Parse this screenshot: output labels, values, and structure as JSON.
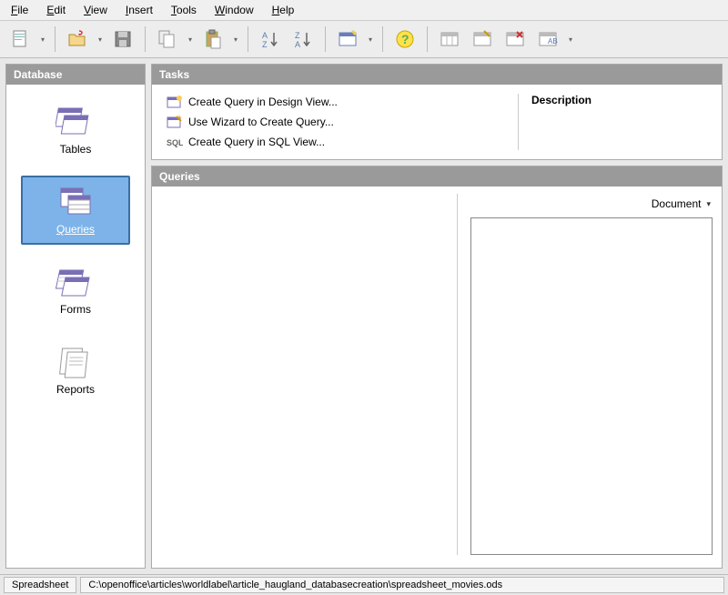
{
  "menu": {
    "file": "File",
    "edit": "Edit",
    "view": "View",
    "insert": "Insert",
    "tools": "Tools",
    "window": "Window",
    "help": "Help"
  },
  "sidebar": {
    "header": "Database",
    "items": [
      {
        "label": "Tables"
      },
      {
        "label": "Queries"
      },
      {
        "label": "Forms"
      },
      {
        "label": "Reports"
      }
    ]
  },
  "tasks": {
    "header": "Tasks",
    "items": [
      {
        "label": "Create Query in Design View..."
      },
      {
        "label": "Use Wizard to Create Query..."
      },
      {
        "label": "Create Query in SQL View..."
      }
    ],
    "description_label": "Description"
  },
  "queries": {
    "header": "Queries",
    "document_label": "Document"
  },
  "status": {
    "type": "Spreadsheet",
    "path": "C:\\openoffice\\articles\\worldlabel\\article_haugland_databasecreation\\spreadsheet_movies.ods"
  }
}
